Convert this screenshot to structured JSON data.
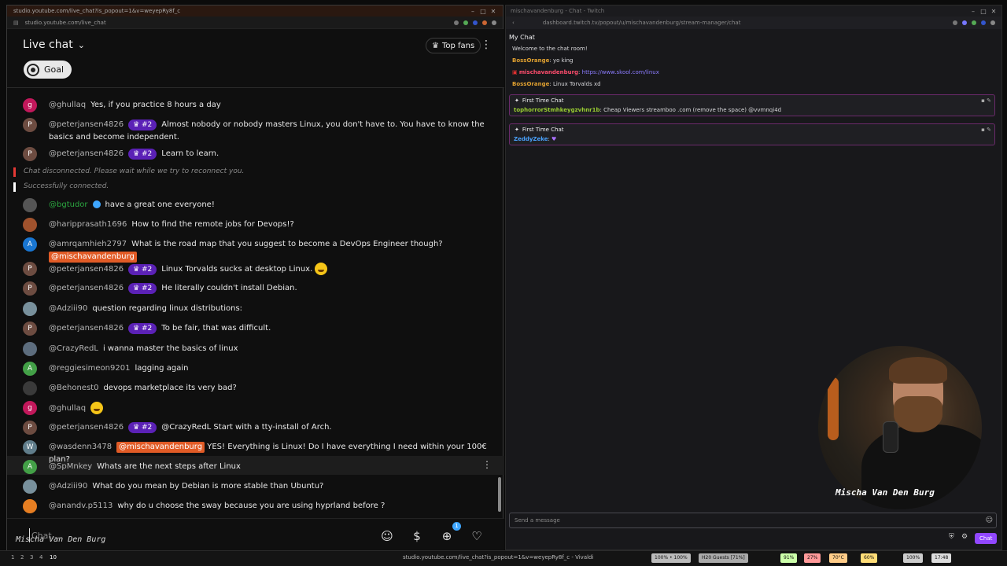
{
  "yt_window": {
    "titlebar": "studio.youtube.com/live_chat?is_popout=1&v=weyepRy8f_c",
    "address": "studio.youtube.com/live_chat",
    "header": {
      "title": "Live chat",
      "top_fans": "Top fans",
      "goal": "Goal"
    },
    "system": {
      "disconnected": "Chat disconnected. Please wait while we try to reconnect you.",
      "connected": "Successfully connected."
    },
    "messages": [
      {
        "initial": "g",
        "author": "@ghullaq",
        "text": "Yes, if you practice 8 hours a day"
      },
      {
        "initial": "P",
        "author": "@peterjansen4826",
        "badge": "#2",
        "text": "Almost nobody or nobody masters Linux, you don't have to. You have to know the basics and become independent."
      },
      {
        "initial": "P",
        "author": "@peterjansen4826",
        "badge": "#2",
        "text": "Learn to learn."
      },
      {
        "initial": "",
        "author": "@bgtudor",
        "text": "have a great one everyone!"
      },
      {
        "initial": "",
        "author": "@haripprasath1696",
        "text": "How to find the remote jobs for Devops!?"
      },
      {
        "initial": "A",
        "author": "@amrqamhieh2797",
        "text": "What is the road map that you suggest to become a DevOps Engineer though?",
        "mention": "@mischavandenburg"
      },
      {
        "initial": "P",
        "author": "@peterjansen4826",
        "badge": "#2",
        "text": "Linux Torvalds sucks at desktop Linux."
      },
      {
        "initial": "P",
        "author": "@peterjansen4826",
        "badge": "#2",
        "text": "He literally couldn't install Debian."
      },
      {
        "initial": "",
        "author": "@Adziii90",
        "text": "question regarding linux distributions:"
      },
      {
        "initial": "P",
        "author": "@peterjansen4826",
        "badge": "#2",
        "text": "To be fair, that was difficult."
      },
      {
        "initial": "",
        "author": "@CrazyRedL",
        "text": "i wanna master the basics of linux"
      },
      {
        "initial": "A",
        "author": "@reggiesimeon9201",
        "text": "lagging again"
      },
      {
        "initial": "",
        "author": "@Behonest0",
        "text": "devops marketplace its very bad?"
      },
      {
        "initial": "g",
        "author": "@ghullaq",
        "text": ""
      },
      {
        "initial": "P",
        "author": "@peterjansen4826",
        "badge": "#2",
        "text": "@CrazyRedL Start with a tty-install of Arch."
      },
      {
        "initial": "W",
        "author": "@wasdenn3478",
        "mention": "@mischavandenburg",
        "text": "YES! Everything is Linux! Do I have everything I need within your 100€ plan?"
      },
      {
        "initial": "A",
        "author": "@SpMnkey",
        "text": "Whats are the next steps after Linux"
      },
      {
        "initial": "",
        "author": "@Adziii90",
        "text": "What do you mean by Debian is more stable than Ubuntu?"
      },
      {
        "initial": "",
        "author": "@anandv.p5113",
        "text": "why do u choose the sway because you are using hyprland before ?"
      }
    ],
    "input": {
      "placeholder": "Chat...",
      "badge_count": "1"
    },
    "watermark": "Mischa Van Den Burg"
  },
  "tw_window": {
    "titlebar": "mischavandenburg - Chat - Twitch",
    "address": "dashboard.twitch.tv/popout/u/mischavandenburg/stream-manager/chat",
    "my_chat": "My Chat",
    "welcome": "Welcome to the chat room!",
    "lines": [
      {
        "user": "BossOrange",
        "text": ": yo king"
      },
      {
        "user": "mischavandenburg",
        "text": ": ",
        "link": "https://www.skool.com/linux"
      },
      {
        "user": "BossOrange",
        "text": ": Linux Torvalds xd"
      }
    ],
    "cards": [
      {
        "title": "First Time Chat",
        "user": "tophorrorStmhkeygzvhnr1b",
        "text": ": Cheap Viewers streamboo .com (remove the space) @vvmnqi4d"
      },
      {
        "title": "First Time Chat",
        "user": "ZeddyZeke",
        "text": ":"
      }
    ],
    "send_placeholder": "Send a message",
    "chat_button": "Chat"
  },
  "webcam": {
    "name": "Mischa Van Den Burg"
  },
  "taskbar": {
    "workspaces": [
      "1",
      "2",
      "3",
      "4",
      "10"
    ],
    "title": "studio.youtube.com/live_chat?is_popout=1&v=weyepRy8f_c - Vivaldi",
    "pills": [
      "100% • 100%",
      "H20 Guests [71%]",
      "91%",
      "27%",
      "70°C",
      "60%",
      "100%",
      "17:48"
    ]
  },
  "colors": {
    "badge_purple": "#5b21b6",
    "mention_orange": "#e15b26",
    "twitch_purple": "#9147ff",
    "author_green": "#2ba640"
  }
}
